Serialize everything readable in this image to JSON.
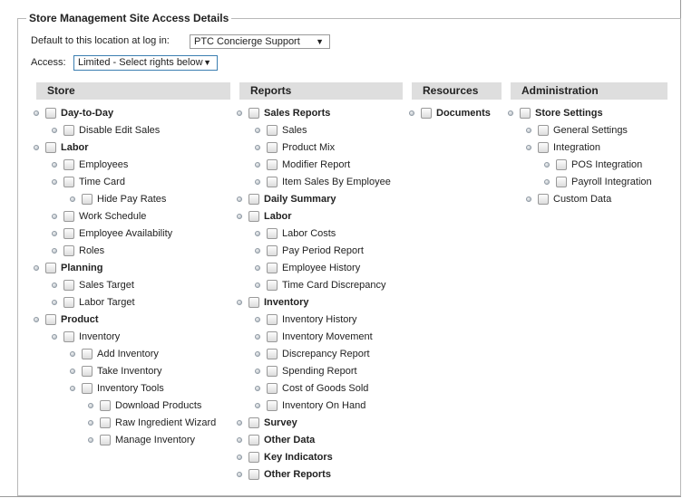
{
  "title": "Store Management Site Access Details",
  "default_location": {
    "label": "Default to this location at log in:",
    "value": "PTC Concierge Support"
  },
  "access": {
    "label": "Access:",
    "value": "Limited - Select rights below"
  },
  "columns": {
    "store": {
      "header": "Store",
      "items": [
        {
          "label": "Day-to-Day",
          "level": 0
        },
        {
          "label": "Disable Edit Sales",
          "level": 1
        },
        {
          "label": "Labor",
          "level": 0
        },
        {
          "label": "Employees",
          "level": 1
        },
        {
          "label": "Time Card",
          "level": 1
        },
        {
          "label": "Hide Pay Rates",
          "level": 2
        },
        {
          "label": "Work Schedule",
          "level": 1
        },
        {
          "label": "Employee Availability",
          "level": 1
        },
        {
          "label": "Roles",
          "level": 1
        },
        {
          "label": "Planning",
          "level": 0
        },
        {
          "label": "Sales Target",
          "level": 1
        },
        {
          "label": "Labor Target",
          "level": 1
        },
        {
          "label": "Product",
          "level": 0
        },
        {
          "label": "Inventory",
          "level": 1
        },
        {
          "label": "Add Inventory",
          "level": 2
        },
        {
          "label": "Take Inventory",
          "level": 2
        },
        {
          "label": "Inventory Tools",
          "level": 2
        },
        {
          "label": "Download Products",
          "level": 3
        },
        {
          "label": "Raw Ingredient Wizard",
          "level": 3
        },
        {
          "label": "Manage Inventory",
          "level": 3
        }
      ]
    },
    "reports": {
      "header": "Reports",
      "items": [
        {
          "label": "Sales Reports",
          "level": 0
        },
        {
          "label": "Sales",
          "level": 1
        },
        {
          "label": "Product Mix",
          "level": 1
        },
        {
          "label": "Modifier Report",
          "level": 1
        },
        {
          "label": "Item Sales By Employee",
          "level": 1
        },
        {
          "label": "Daily Summary",
          "level": 0
        },
        {
          "label": "Labor",
          "level": 0
        },
        {
          "label": "Labor Costs",
          "level": 1
        },
        {
          "label": "Pay Period Report",
          "level": 1
        },
        {
          "label": "Employee History",
          "level": 1
        },
        {
          "label": "Time Card Discrepancy",
          "level": 1
        },
        {
          "label": "Inventory",
          "level": 0
        },
        {
          "label": "Inventory History",
          "level": 1
        },
        {
          "label": "Inventory Movement",
          "level": 1
        },
        {
          "label": "Discrepancy Report",
          "level": 1
        },
        {
          "label": "Spending Report",
          "level": 1
        },
        {
          "label": "Cost of Goods Sold",
          "level": 1
        },
        {
          "label": "Inventory On Hand",
          "level": 1
        },
        {
          "label": "Survey",
          "level": 0
        },
        {
          "label": "Other Data",
          "level": 0
        },
        {
          "label": "Key Indicators",
          "level": 0
        },
        {
          "label": "Other Reports",
          "level": 0
        }
      ]
    },
    "resources": {
      "header": "Resources",
      "items": [
        {
          "label": "Documents",
          "level": 0
        }
      ]
    },
    "administration": {
      "header": "Administration",
      "items": [
        {
          "label": "Store Settings",
          "level": 0
        },
        {
          "label": "General Settings",
          "level": 1
        },
        {
          "label": "Integration",
          "level": 1
        },
        {
          "label": "POS Integration",
          "level": 2
        },
        {
          "label": "Payroll Integration",
          "level": 2
        },
        {
          "label": "Custom Data",
          "level": 1
        }
      ]
    }
  }
}
